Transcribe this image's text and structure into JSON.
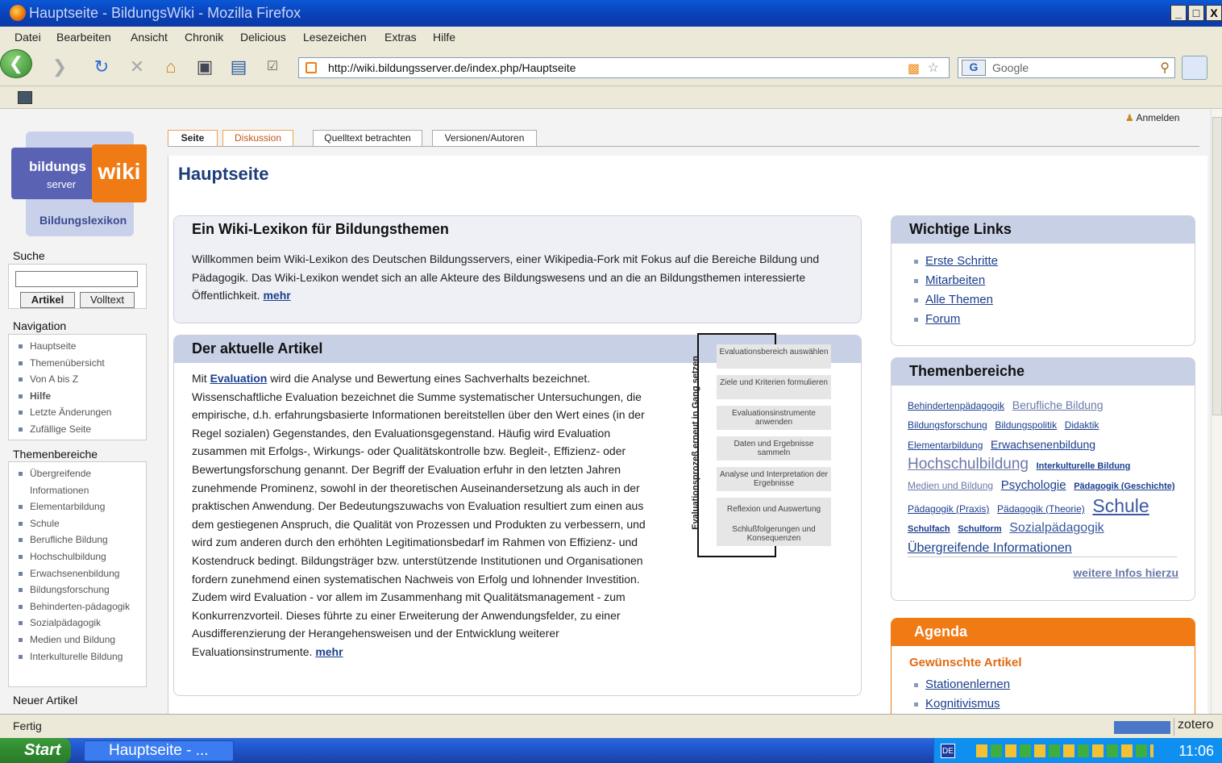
{
  "window": {
    "title": "Hauptseite - BildungsWiki - Mozilla Firefox",
    "min": "_",
    "max": "□",
    "close": "X"
  },
  "menu": [
    "Datei",
    "Bearbeiten",
    "Ansicht",
    "Chronik",
    "Delicious",
    "Lesezeichen",
    "Extras",
    "Hilfe"
  ],
  "browser": {
    "url": "http://wiki.bildungsserver.de/index.php/Hauptseite",
    "search_placeholder": "Google"
  },
  "status": {
    "text": "Fertig",
    "zotero": "zotero"
  },
  "taskbar": {
    "start": "Start",
    "task": "Hauptseite - ...",
    "clock": "11:06",
    "lang": "DE"
  },
  "wiki": {
    "logo": {
      "line1": "bildungs",
      "line2": "server",
      "wiki": "wiki",
      "sub": "Bildungslexikon"
    },
    "login": "Anmelden",
    "search": {
      "heading": "Suche",
      "btn_article": "Artikel",
      "btn_fulltext": "Volltext"
    },
    "nav": {
      "heading": "Navigation",
      "items": [
        "Hauptseite",
        "Themenübersicht",
        "Von A bis Z",
        "Hilfe",
        "Letzte Änderungen",
        "Zufällige Seite"
      ]
    },
    "themen_side": {
      "heading": "Themenbereiche",
      "items": [
        "Übergreifende Informationen",
        "Elementarbildung",
        "Schule",
        "Berufliche Bildung",
        "Hochschulbildung",
        "Erwachsenenbildung",
        "Bildungsforschung",
        "Behinderten-pädagogik",
        "Sozialpädagogik",
        "Medien und Bildung",
        "Interkulturelle Bildung"
      ]
    },
    "neuer_artikel": "Neuer Artikel",
    "tabs": [
      "Seite",
      "Diskussion",
      "Quelltext betrachten",
      "Versionen/Autoren"
    ],
    "page_title": "Hauptseite",
    "intro": {
      "heading": "Ein Wiki-Lexikon für Bildungsthemen",
      "text": "Willkommen beim Wiki-Lexikon des Deutschen Bildungsservers, einer Wikipedia-Fork mit Fokus auf die Bereiche Bildung und Pädagogik. Das Wiki-Lexikon wendet sich an alle Akteure des Bildungswesens und an die an Bildungsthemen interessierte Öffentlichkeit.",
      "more": "mehr"
    },
    "article": {
      "heading": "Der aktuelle Artikel",
      "lead": "Mit",
      "link": "Evaluation",
      "text": "wird die Analyse und Bewertung eines Sachverhalts bezeichnet. Wissenschaftliche Evaluation bezeichnet die Summe systematischer Untersuchungen, die empirische, d.h. erfahrungsbasierte Informationen bereitstellen über den Wert eines (in der Regel sozialen) Gegenstandes, den Evaluationsgegenstand. Häufig wird Evaluation zusammen mit Erfolgs-, Wirkungs- oder Qualitätskontrolle bzw. Begleit-, Effizienz- oder Bewertungsforschung genannt. Der Begriff der Evaluation erfuhr in den letzten Jahren zunehmende Prominenz, sowohl in der theoretischen Auseinandersetzung als auch in der praktischen Anwendung. Der Bedeutungszuwachs von Evaluation resultiert zum einen aus dem gestiegenen Anspruch, die Qualität von Prozessen und Produkten zu verbessern, und wird zum anderen durch den erhöhten Legitimationsbedarf im Rahmen von Effizienz- und Kostendruck bedingt. Bildungsträger bzw. unterstützende Institutionen und Organisationen fordern zunehmend einen systematischen Nachweis von Erfolg und lohnender Investition. Zudem wird Evaluation - vor allem im Zusammenhang mit Qualitätsmanagement - zum Konkurrenzvorteil. Dieses führte zu einer Erweiterung der Anwendungsfelder, zu einer Ausdifferenzierung der Herangehensweisen und der Entwicklung weiterer Evaluationsinstrumente.",
      "more": "mehr"
    },
    "diagram": {
      "side_label": "Evaluationsprozeß erneut in Gang setzen",
      "steps": [
        "Evaluationsbereich auswählen",
        "Ziele und Kriterien formulieren",
        "Evaluationsinstrumente anwenden",
        "Daten und Ergebnisse sammeln",
        "Analyse und Interpretation der Ergebnisse",
        "Reflexion und Auswertung",
        "Schlußfolgerungen und Konsequenzen"
      ]
    },
    "wichtige": {
      "heading": "Wichtige Links",
      "items": [
        "Erste Schritte",
        "Mitarbeiten",
        "Alle Themen",
        "Forum"
      ]
    },
    "themen_cloud": {
      "heading": "Themenbereiche",
      "items": [
        "Behindertenpädagogik",
        "Berufliche Bildung",
        "Bildungsforschung",
        "Bildungspolitik",
        "Didaktik",
        "Elementarbildung",
        "Erwachsenenbildung",
        "Hochschulbildung",
        "Interkulturelle Bildung",
        "Medien und Bildung",
        "Psychologie",
        "Pädagogik (Geschichte)",
        "Pädagogik (Praxis)",
        "Pädagogik (Theorie)",
        "Schule",
        "Schulfach",
        "Schulform",
        "Sozialpädagogik",
        "Übergreifende Informationen"
      ],
      "more": "weitere Infos hierzu"
    },
    "agenda": {
      "heading": "Agenda",
      "sub": "Gewünschte Artikel",
      "items": [
        "Stationenlernen",
        "Kognitivismus"
      ]
    }
  }
}
